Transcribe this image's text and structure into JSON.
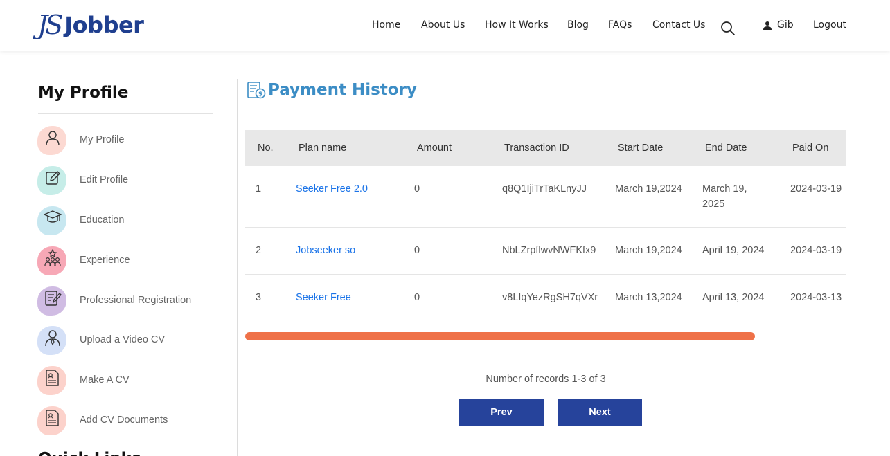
{
  "header": {
    "brand_mark": "JS",
    "brand_name": "Jobber",
    "nav": [
      "Home",
      "About Us",
      "How It Works",
      "Blog",
      "FAQs",
      "Contact Us"
    ],
    "user_name": "Gib",
    "logout_label": "Logout",
    "icons": {
      "search": "search-icon",
      "user": "user-icon"
    }
  },
  "sidebar": {
    "title": "My Profile",
    "items": [
      {
        "label": "My Profile",
        "icon": "user-icon",
        "color": "#fcd9d2"
      },
      {
        "label": "Edit Profile",
        "icon": "edit-icon",
        "color": "#c6ede8"
      },
      {
        "label": "Education",
        "icon": "graduation-cap-icon",
        "color": "#c7e7f0"
      },
      {
        "label": "Experience",
        "icon": "team-star-icon",
        "color": "#f7a8b6"
      },
      {
        "label": "Professional Registration",
        "icon": "document-pen-icon",
        "color": "#d0bce3"
      },
      {
        "label": "Upload a Video CV",
        "icon": "user-tie-icon",
        "color": "#d4e0f7"
      },
      {
        "label": "Make A CV",
        "icon": "resume-icon",
        "color": "#fcd2cb"
      },
      {
        "label": "Add CV Documents",
        "icon": "resume-icon",
        "color": "#fcd2cb"
      }
    ],
    "next_section_peek": "Quick Links"
  },
  "main": {
    "title": "Payment History",
    "title_icon": "receipt-icon",
    "columns": [
      "No.",
      "Plan name",
      "Amount",
      "Transaction ID",
      "Start Date",
      "End Date",
      "Paid On"
    ],
    "rows": [
      {
        "no": "1",
        "plan": "Seeker Free 2.0",
        "amount": "0",
        "txn": "q8Q1IjiTrTaKLnyJJ",
        "start": "March 19,2024",
        "end": "March 19, 2025",
        "paid": "2024-03-19"
      },
      {
        "no": "2",
        "plan": "Jobseeker so",
        "amount": "0",
        "txn": "NbLZrpflwvNWFKfx9",
        "start": "March 19,2024",
        "end": "April 19, 2024",
        "paid": "2024-03-19"
      },
      {
        "no": "3",
        "plan": "Seeker Free",
        "amount": "0",
        "txn": "v8LIqYezRgSH7qVXr",
        "start": "March 13,2024",
        "end": "April 13, 2024",
        "paid": "2024-03-13"
      }
    ],
    "records_text": "Number of records 1-3 of 3",
    "prev_label": "Prev",
    "next_label": "Next",
    "colors": {
      "title": "#3c8dc5",
      "link": "#1a73e8",
      "scrollbar": "#ef7148",
      "button": "#26439b",
      "header_bg": "#e8e8e8"
    }
  }
}
